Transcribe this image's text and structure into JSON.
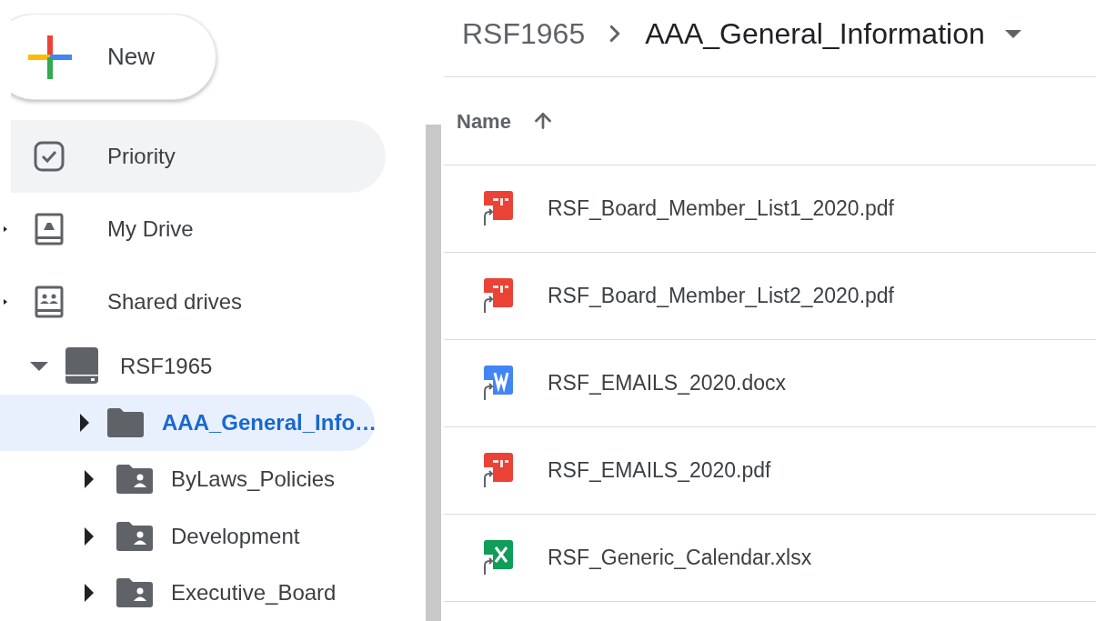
{
  "new_button": {
    "label": "New"
  },
  "nav": [
    {
      "label": "Priority",
      "kind": "priority",
      "highlighted": true,
      "expandable": false
    },
    {
      "label": "My Drive",
      "kind": "drive",
      "highlighted": false,
      "expandable": true
    },
    {
      "label": "Shared drives",
      "kind": "shared",
      "highlighted": false,
      "expandable": true
    }
  ],
  "tree": [
    {
      "label": "RSF1965",
      "kind": "shared-drive",
      "expanded": true,
      "selected": false,
      "children": [
        {
          "label": "AAA_General_Info…",
          "kind": "folder",
          "expanded": false,
          "selected": true
        },
        {
          "label": "ByLaws_Policies",
          "kind": "shared-folder",
          "expanded": false,
          "selected": false
        },
        {
          "label": "Development",
          "kind": "shared-folder",
          "expanded": false,
          "selected": false
        },
        {
          "label": "Executive_Board",
          "kind": "shared-folder",
          "expanded": false,
          "selected": false
        }
      ]
    }
  ],
  "breadcrumb": [
    "RSF1965",
    "AAA_General_Information"
  ],
  "table": {
    "columns": [
      {
        "label": "Name",
        "sorted_ascending": true
      }
    ],
    "rows": [
      {
        "name": "RSF_Board_Member_List1_2020.pdf",
        "kind": "pdf",
        "shortcut": true
      },
      {
        "name": "RSF_Board_Member_List2_2020.pdf",
        "kind": "pdf",
        "shortcut": true
      },
      {
        "name": "RSF_EMAILS_2020.docx",
        "kind": "docx",
        "shortcut": true
      },
      {
        "name": "RSF_EMAILS_2020.pdf",
        "kind": "pdf",
        "shortcut": true
      },
      {
        "name": "RSF_Generic_Calendar.xlsx",
        "kind": "xlsx",
        "shortcut": true
      }
    ]
  }
}
